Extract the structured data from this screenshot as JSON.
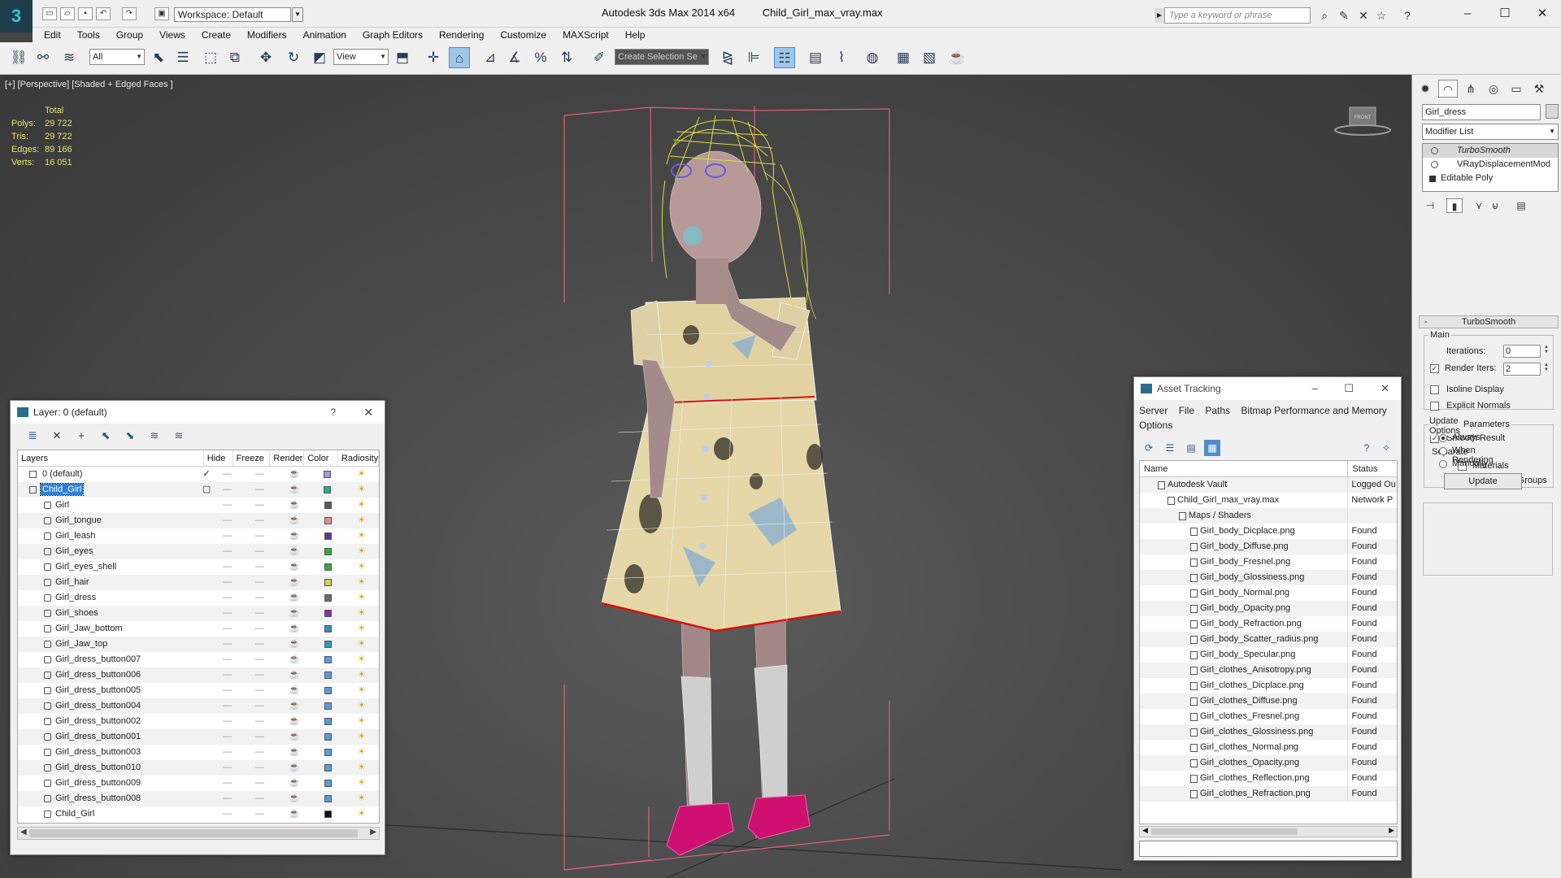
{
  "titlebar": {
    "workspace": "Workspace: Default",
    "app_name": "Autodesk 3ds Max  2014 x64",
    "file_name": "Child_Girl_max_vray.max",
    "search_placeholder": "Type a keyword or phrase",
    "logo_text": "3"
  },
  "menu": [
    "Edit",
    "Tools",
    "Group",
    "Views",
    "Create",
    "Modifiers",
    "Animation",
    "Graph Editors",
    "Rendering",
    "Customize",
    "MAXScript",
    "Help"
  ],
  "toolbar": {
    "filter": "All",
    "ref_coord": "View",
    "selection_set": "Create Selection Se"
  },
  "viewport": {
    "label": "[+] [Perspective] [Shaded + Edged Faces ]",
    "stats_header": "Total",
    "stats": [
      {
        "key": "Polys:",
        "value": "29 722"
      },
      {
        "key": "Tris:",
        "value": "29 722"
      },
      {
        "key": "Edges:",
        "value": "89 166"
      },
      {
        "key": "Verts:",
        "value": "16 051"
      }
    ],
    "viewcube_label": "FRONT"
  },
  "command_panel": {
    "object_name": "Girl_dress",
    "modifier_list": "Modifier List",
    "stack": [
      {
        "label": "TurboSmooth",
        "type": "modifier",
        "selected": true
      },
      {
        "label": "VRayDisplacementMod",
        "type": "modifier",
        "selected": false
      },
      {
        "label": "Editable Poly",
        "type": "base",
        "selected": false
      }
    ],
    "rollout_title": "TurboSmooth",
    "main_label": "Main",
    "iterations_label": "Iterations:",
    "iterations_value": "0",
    "render_iters_label": "Render Iters:",
    "render_iters_value": "2",
    "isoline_label": "Isoline Display",
    "explicit_normals_label": "Explicit Normals",
    "surface_label": "Surface Parameters",
    "smooth_result_label": "Smooth Result",
    "separate_label": "Separate",
    "materials_label": "Materials",
    "smoothing_groups_label": "Smoothing Groups",
    "update_options_label": "Update Options",
    "always_label": "Always",
    "when_rendering_label": "When Rendering",
    "manually_label": "Manually",
    "update_button": "Update"
  },
  "layer_window": {
    "title": "Layer: 0 (default)",
    "help": "?",
    "columns": [
      "Layers",
      "Hide",
      "Freeze",
      "Render",
      "Color",
      "Radiosity"
    ],
    "rows": [
      {
        "name": "0 (default)",
        "level": 0,
        "color": "#a79ad6",
        "mark": "✓"
      },
      {
        "name": "Child_Girl",
        "level": 0,
        "color": "#1fb08e",
        "mark": "▢",
        "selected": true
      },
      {
        "name": "Girl",
        "level": 1,
        "color": "#5a5a5a"
      },
      {
        "name": "Girl_tongue",
        "level": 1,
        "color": "#e39090"
      },
      {
        "name": "Girl_leash",
        "level": 1,
        "color": "#5a3a9a"
      },
      {
        "name": "Girl_eyes",
        "level": 1,
        "color": "#3aa63a"
      },
      {
        "name": "Girl_eyes_shell",
        "level": 1,
        "color": "#3aa63a"
      },
      {
        "name": "Girl_hair",
        "level": 1,
        "color": "#c7d44a"
      },
      {
        "name": "Girl_dress",
        "level": 1,
        "color": "#6a6a6a"
      },
      {
        "name": "Girl_shoes",
        "level": 1,
        "color": "#8a2ea6"
      },
      {
        "name": "Girl_Jaw_bottom",
        "level": 1,
        "color": "#3a8ac6"
      },
      {
        "name": "Girl_Jaw_top",
        "level": 1,
        "color": "#2a9ac6"
      },
      {
        "name": "Girl_dress_button007",
        "level": 1,
        "color": "#5a9ae0"
      },
      {
        "name": "Girl_dress_button006",
        "level": 1,
        "color": "#5a9ae0"
      },
      {
        "name": "Girl_dress_button005",
        "level": 1,
        "color": "#5a9ae0"
      },
      {
        "name": "Girl_dress_button004",
        "level": 1,
        "color": "#5a9ae0"
      },
      {
        "name": "Girl_dress_button002",
        "level": 1,
        "color": "#5a9ae0"
      },
      {
        "name": "Girl_dress_button001",
        "level": 1,
        "color": "#5a9ae0"
      },
      {
        "name": "Girl_dress_button003",
        "level": 1,
        "color": "#5a9ae0"
      },
      {
        "name": "Girl_dress_button010",
        "level": 1,
        "color": "#5a9ae0"
      },
      {
        "name": "Girl_dress_button009",
        "level": 1,
        "color": "#5a9ae0"
      },
      {
        "name": "Girl_dress_button008",
        "level": 1,
        "color": "#5a9ae0"
      },
      {
        "name": "Child_Girl",
        "level": 1,
        "color": "#111111"
      }
    ]
  },
  "asset_window": {
    "title": "Asset Tracking",
    "menu": [
      "Server",
      "File",
      "Paths",
      "Bitmap Performance and Memory",
      "Options"
    ],
    "columns": [
      "Name",
      "Status"
    ],
    "rows": [
      {
        "name": "Autodesk Vault",
        "level": 1,
        "status": "Logged Ou"
      },
      {
        "name": "Child_Girl_max_vray.max",
        "level": 2,
        "status": "Network P"
      },
      {
        "name": "Maps / Shaders",
        "level": 3,
        "status": ""
      },
      {
        "name": "Girl_body_Dicplace.png",
        "level": 4,
        "status": "Found"
      },
      {
        "name": "Girl_body_Diffuse.png",
        "level": 4,
        "status": "Found"
      },
      {
        "name": "Girl_body_Fresnel.png",
        "level": 4,
        "status": "Found"
      },
      {
        "name": "Girl_body_Glossiness.png",
        "level": 4,
        "status": "Found"
      },
      {
        "name": "Girl_body_Normal.png",
        "level": 4,
        "status": "Found"
      },
      {
        "name": "Girl_body_Opacity.png",
        "level": 4,
        "status": "Found"
      },
      {
        "name": "Girl_body_Refraction.png",
        "level": 4,
        "status": "Found"
      },
      {
        "name": "Girl_body_Scatter_radius.png",
        "level": 4,
        "status": "Found"
      },
      {
        "name": "Girl_body_Specular.png",
        "level": 4,
        "status": "Found"
      },
      {
        "name": "Girl_clothes_Anisotropy.png",
        "level": 4,
        "status": "Found"
      },
      {
        "name": "Girl_clothes_Dicplace.png",
        "level": 4,
        "status": "Found"
      },
      {
        "name": "Girl_clothes_Diffuse.png",
        "level": 4,
        "status": "Found"
      },
      {
        "name": "Girl_clothes_Fresnel.png",
        "level": 4,
        "status": "Found"
      },
      {
        "name": "Girl_clothes_Glossiness.png",
        "level": 4,
        "status": "Found"
      },
      {
        "name": "Girl_clothes_Normal.png",
        "level": 4,
        "status": "Found"
      },
      {
        "name": "Girl_clothes_Opacity.png",
        "level": 4,
        "status": "Found"
      },
      {
        "name": "Girl_clothes_Reflection.png",
        "level": 4,
        "status": "Found"
      },
      {
        "name": "Girl_clothes_Refraction.png",
        "level": 4,
        "status": "Found"
      }
    ]
  },
  "colors": {
    "accent": "#2f7fd8",
    "stats_text": "#e8e070",
    "bbox": "#e0607a",
    "wire_yellow": "#d8e040",
    "dress": "#e6d7a8",
    "shoes": "#d01070"
  }
}
